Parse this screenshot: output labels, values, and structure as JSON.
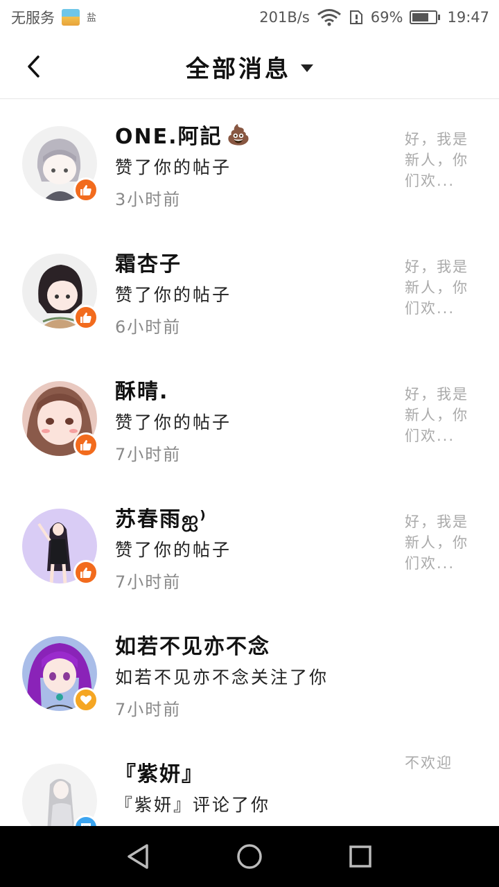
{
  "status_bar": {
    "carrier": "无服务",
    "speed": "201B/s",
    "battery_percent": "69%",
    "battery_level": 0.69,
    "time": "19:47",
    "small_label": "盐"
  },
  "header": {
    "title": "全部消息"
  },
  "messages": [
    {
      "name": "ONE.阿記",
      "name_emoji": "💩",
      "action": "赞了你的帖子",
      "time": "3小时前",
      "preview": "好，我是新人，你们欢...",
      "badge": "like",
      "badge_color": "#F26B1D"
    },
    {
      "name": "霜杏子",
      "name_emoji": "",
      "action": "赞了你的帖子",
      "time": "6小时前",
      "preview": "好，我是新人，你们欢...",
      "badge": "like",
      "badge_color": "#F26B1D"
    },
    {
      "name": "酥晴.",
      "name_emoji": "",
      "action": "赞了你的帖子",
      "time": "7小时前",
      "preview": "好，我是新人，你们欢...",
      "badge": "like",
      "badge_color": "#F26B1D"
    },
    {
      "name": "苏春雨ஐ⁾",
      "name_emoji": "",
      "action": "赞了你的帖子",
      "time": "7小时前",
      "preview": "好，我是新人，你们欢...",
      "badge": "like",
      "badge_color": "#F26B1D"
    },
    {
      "name": "如若不见亦不念",
      "name_emoji": "",
      "action": "如若不见亦不念关注了你",
      "time": "7小时前",
      "preview": "",
      "badge": "heart",
      "badge_color": "#F5A623"
    },
    {
      "name": "『紫妍』",
      "name_emoji": "",
      "action": "『紫妍』评论了你",
      "time": "",
      "preview": "不欢迎",
      "badge": "comment",
      "badge_color": "#3BA4F0"
    }
  ],
  "icons": {
    "back": "chevron-left-icon",
    "dropdown": "caret-down-icon",
    "like": "thumbs-up-icon",
    "heart": "heart-icon",
    "comment": "comment-icon",
    "nav_back": "triangle-back-icon",
    "nav_home": "circle-home-icon",
    "nav_recent": "square-recent-icon"
  }
}
